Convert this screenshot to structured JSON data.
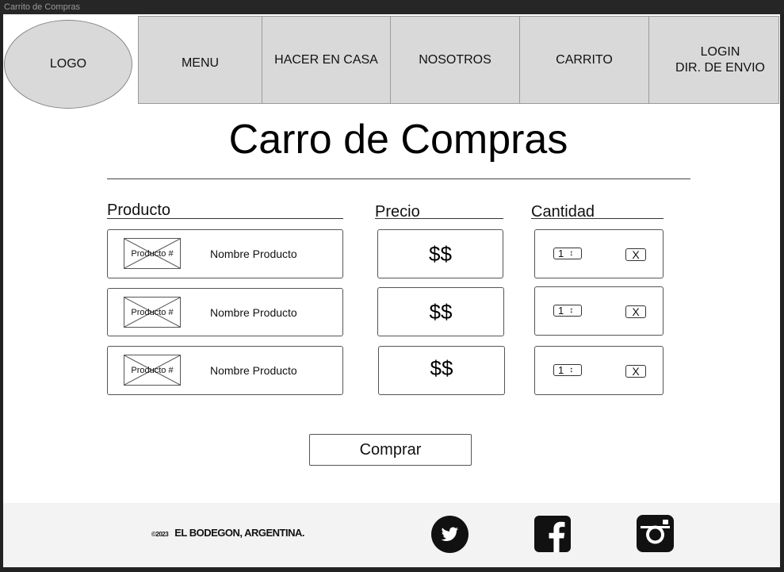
{
  "window": {
    "title": "Carrito de Compras"
  },
  "header": {
    "logo": "LOGO",
    "nav": [
      "MENU",
      "HACER EN CASA",
      "NOSOTROS",
      "CARRITO",
      "LOGIN\nDIR. DE ENVIO"
    ]
  },
  "main": {
    "title": "Carro de Compras",
    "columns": {
      "product": "Producto",
      "price": "Precio",
      "quantity": "Cantidad"
    },
    "rows": [
      {
        "thumb": "Producto #",
        "name": "Nombre Producto",
        "price": "$$",
        "qty": "1",
        "remove": "X"
      },
      {
        "thumb": "Producto #",
        "name": "Nombre Producto",
        "price": "$$",
        "qty": "1",
        "remove": "X"
      },
      {
        "thumb": "Producto #",
        "name": "Nombre Producto",
        "price": "$$",
        "qty": "1",
        "remove": "X"
      }
    ],
    "buy_label": "Comprar"
  },
  "footer": {
    "copyright_symbol": "©2023",
    "copyright": "EL BODEGON, ARGENTINA.",
    "social": [
      "twitter-icon",
      "facebook-icon",
      "instagram-icon"
    ]
  }
}
